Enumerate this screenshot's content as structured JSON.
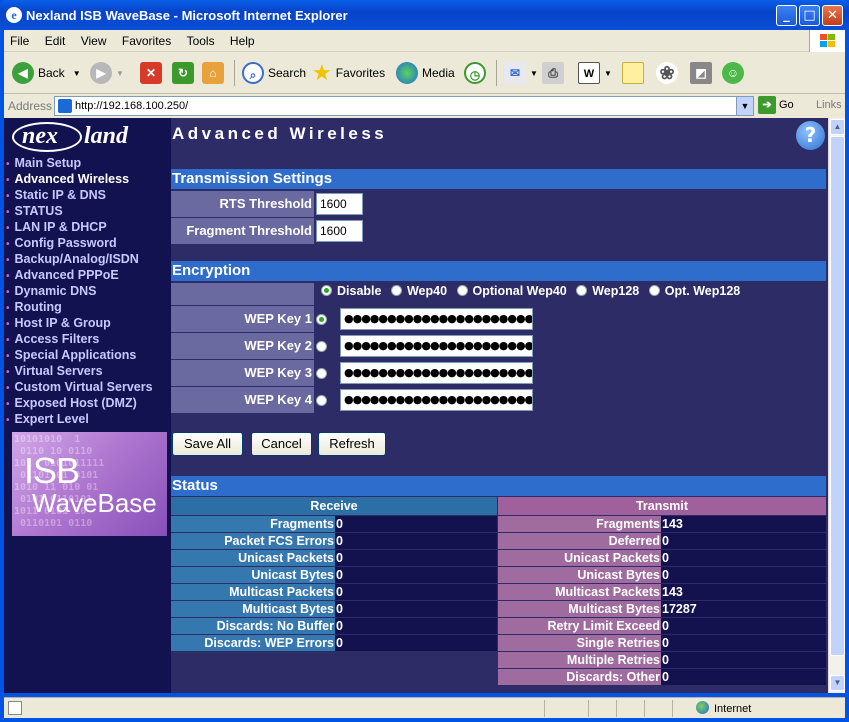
{
  "window": {
    "title": "Nexland ISB WaveBase - Microsoft Internet Explorer",
    "buttons": {
      "minimize": "_",
      "maximize": "□",
      "close": "✕"
    }
  },
  "menu": [
    "File",
    "Edit",
    "View",
    "Favorites",
    "Tools",
    "Help"
  ],
  "toolbar": {
    "back": "Back",
    "search": "Search",
    "favorites": "Favorites",
    "media": "Media"
  },
  "address": {
    "label": "Address",
    "url": "http://192.168.100.250/",
    "go": "Go",
    "links": "Links"
  },
  "page": {
    "logo": {
      "left": "nex",
      "right": "land"
    },
    "title": "Advanced Wireless",
    "help": "?",
    "nav": [
      "Main Setup",
      "Advanced Wireless",
      "Static IP & DNS",
      "STATUS",
      "LAN IP & DHCP",
      "Config Password",
      "Backup/Analog/ISDN",
      "Advanced PPPoE",
      "Dynamic DNS",
      "Routing",
      "Host IP & Group",
      "Access Filters",
      "Special Applications",
      "Virtual Servers",
      "Custom Virtual Servers",
      "Exposed Host (DMZ)",
      "Expert Level"
    ],
    "promo": {
      "line1": "ISB",
      "line2": "WaveBase"
    },
    "transmission": {
      "heading": "Transmission Settings",
      "rts_label": "RTS Threshold",
      "rts_value": "1600",
      "frag_label": "Fragment Threshold",
      "frag_value": "1600"
    },
    "encryption": {
      "heading": "Encryption",
      "options": [
        "Disable",
        "Wep40",
        "Optional Wep40",
        "Wep128",
        "Opt. Wep128"
      ],
      "selected_option": "Disable",
      "keys": [
        {
          "label": "WEP Key 1",
          "value": "●●●●●●●●●●●●●●●●●●●●●●●●●●",
          "selected": true
        },
        {
          "label": "WEP Key 2",
          "value": "●●●●●●●●●●●●●●●●●●●●●●●●●●",
          "selected": false
        },
        {
          "label": "WEP Key 3",
          "value": "●●●●●●●●●●●●●●●●●●●●●●●●●●",
          "selected": false
        },
        {
          "label": "WEP Key 4",
          "value": "●●●●●●●●●●●●●●●●●●●●●●●●●●",
          "selected": false
        }
      ]
    },
    "buttons": {
      "save": "Save All",
      "cancel": "Cancel",
      "refresh": "Refresh"
    },
    "status": {
      "heading": "Status",
      "receive_heading": "Receive",
      "transmit_heading": "Transmit",
      "receive": [
        {
          "k": "Fragments",
          "v": "0"
        },
        {
          "k": "Packet FCS Errors",
          "v": "0"
        },
        {
          "k": "Unicast Packets",
          "v": "0"
        },
        {
          "k": "Unicast Bytes",
          "v": "0"
        },
        {
          "k": "Multicast Packets",
          "v": "0"
        },
        {
          "k": "Multicast Bytes",
          "v": "0"
        },
        {
          "k": "Discards: No Buffer",
          "v": "0"
        },
        {
          "k": "Discards: WEP Errors",
          "v": "0"
        }
      ],
      "transmit": [
        {
          "k": "Fragments",
          "v": "143"
        },
        {
          "k": "Deferred",
          "v": "0"
        },
        {
          "k": "Unicast Packets",
          "v": "0"
        },
        {
          "k": "Unicast Bytes",
          "v": "0"
        },
        {
          "k": "Multicast Packets",
          "v": "143"
        },
        {
          "k": "Multicast Bytes",
          "v": "17287"
        },
        {
          "k": "Retry Limit Exceed",
          "v": "0"
        },
        {
          "k": "Single Retries",
          "v": "0"
        },
        {
          "k": "Multiple Retries",
          "v": "0"
        },
        {
          "k": "Discards: Other",
          "v": "0"
        }
      ]
    }
  },
  "statusbar": {
    "zone": "Internet"
  },
  "colors": {
    "titlebar": "#0a4fd6",
    "page_bg": "#2e2c66",
    "sidebar_bg": "#131250",
    "section_header": "#2f6dcc",
    "label_cell": "#6a6aa0",
    "receive_header": "#2c6fa6",
    "receive_cell": "#3578b0",
    "transmit_header": "#a0609c",
    "transmit_cell": "#a06ca0"
  }
}
